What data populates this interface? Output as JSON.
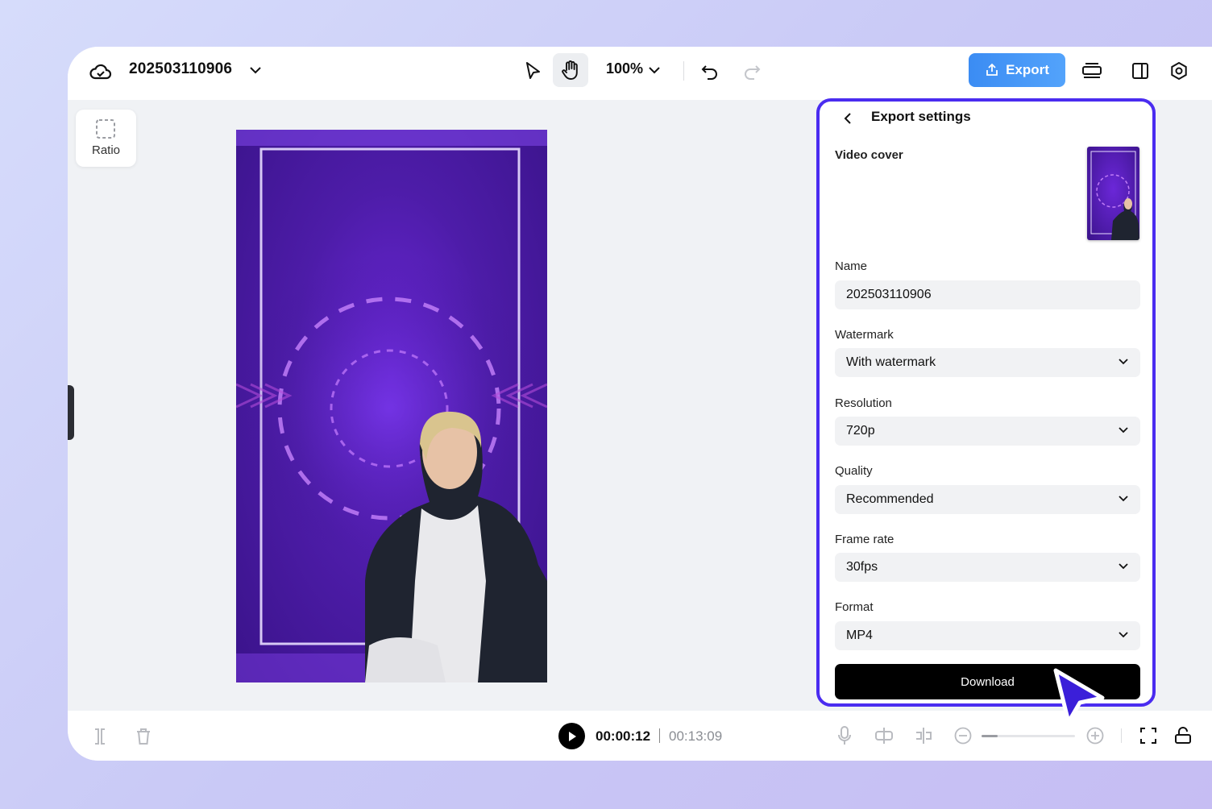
{
  "header": {
    "project_title": "202503110906",
    "zoom": "100%",
    "export_label": "Export"
  },
  "sidebar": {
    "ratio_label": "Ratio"
  },
  "playback": {
    "current_time": "00:00:12",
    "total_time": "00:13:09"
  },
  "export_panel": {
    "title": "Export settings",
    "video_cover_label": "Video cover",
    "fields": [
      {
        "label": "Name",
        "value": "202503110906"
      },
      {
        "label": "Watermark",
        "value": "With watermark"
      },
      {
        "label": "Resolution",
        "value": "720p"
      },
      {
        "label": "Quality",
        "value": "Recommended"
      },
      {
        "label": "Frame rate",
        "value": "30fps"
      },
      {
        "label": "Format",
        "value": "MP4"
      }
    ],
    "download_label": "Download"
  },
  "colors": {
    "accent": "#4a2cf0",
    "export_button": "#3b8cf3",
    "canvas_purple": "#4d1ca8"
  }
}
